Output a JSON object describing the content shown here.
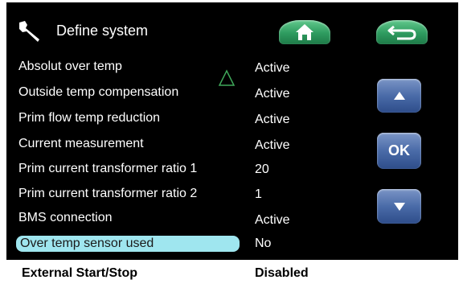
{
  "header": {
    "title": "Define system",
    "icon": "wrench-icon"
  },
  "toolbar": {
    "home_icon": "home-icon",
    "back_icon": "back-arrow-icon"
  },
  "nav": {
    "up_icon": "arrow-up-icon",
    "ok_label": "OK",
    "down_icon": "arrow-down-icon"
  },
  "settings": [
    {
      "label": "Absolut over temp",
      "value": "Active"
    },
    {
      "label": "Outside temp compensation",
      "value": "Active"
    },
    {
      "label": "Prim flow temp reduction",
      "value": "Active"
    },
    {
      "label": "Current measurement",
      "value": "Active"
    },
    {
      "label": "Prim current transformer ratio 1",
      "value": "20"
    },
    {
      "label": "Prim current transformer ratio 2",
      "value": "1"
    },
    {
      "label": "BMS connection",
      "value": "Active"
    },
    {
      "label": "Over temp sensor used",
      "value": "No"
    }
  ],
  "footer": {
    "label": "External Start/Stop",
    "value": "Disabled"
  },
  "colors": {
    "background": "#000000",
    "highlight": "#9fe6ef",
    "green_button": "#2e9b5f",
    "blue_button": "#4a6ba8",
    "text": "#ffffff"
  }
}
